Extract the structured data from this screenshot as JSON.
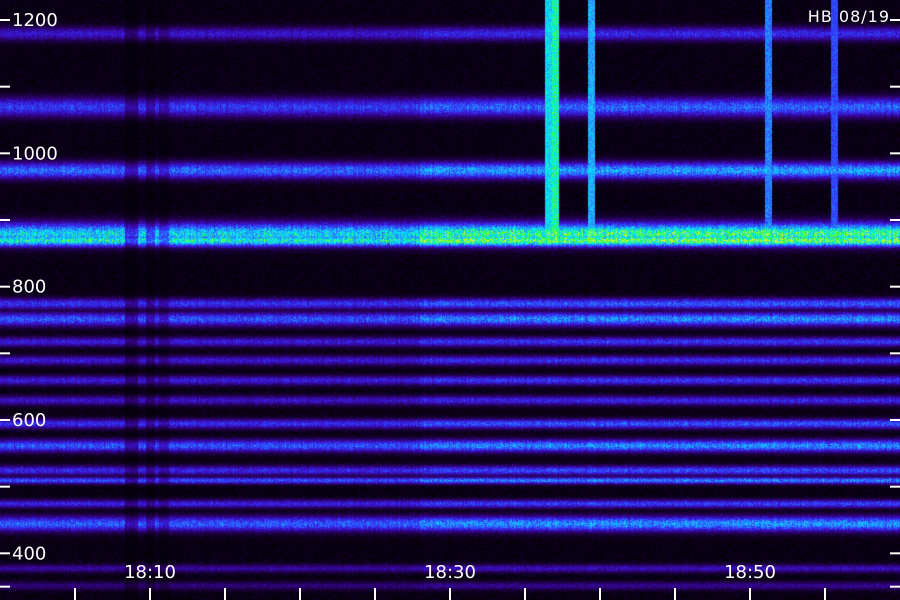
{
  "chart_data": {
    "type": "heatmap",
    "title": "",
    "xlabel": "",
    "ylabel": "",
    "corner_label": "HB 08/19",
    "x_unit": "time (HH:MM)",
    "xlim": [
      "18:00",
      "19:00"
    ],
    "ylim": [
      330,
      1230
    ],
    "y_ticks": [
      {
        "value": 1200,
        "label": "1200"
      },
      {
        "value": 1000,
        "label": "1000"
      },
      {
        "value": 800,
        "label": "800"
      },
      {
        "value": 600,
        "label": "600"
      },
      {
        "value": 400,
        "label": "400"
      }
    ],
    "y_minor_ticks": [
      1100,
      900,
      700,
      500,
      350
    ],
    "x_ticks": [
      {
        "time": "18:10",
        "label": "18:10"
      },
      {
        "time": "18:30",
        "label": "18:30"
      },
      {
        "time": "18:50",
        "label": "18:50"
      }
    ],
    "x_minor_ticks": [
      "18:05",
      "18:15",
      "18:20",
      "18:25",
      "18:35",
      "18:40",
      "18:45",
      "18:55"
    ],
    "colormap": [
      "#000000",
      "#2a0060",
      "#3a10c8",
      "#2f45ff",
      "#25a0ff",
      "#00f0ff",
      "#30ff40",
      "#e8ff20"
    ],
    "segments": [
      {
        "start": "18:00",
        "end": "18:28",
        "gain": 0.82
      },
      {
        "start": "18:28",
        "end": "19:00",
        "gain": 1.0
      }
    ],
    "bands": [
      {
        "freq": 1180,
        "width": 10,
        "intensity": 0.33
      },
      {
        "freq": 1070,
        "width": 14,
        "intensity": 0.45
      },
      {
        "freq": 975,
        "width": 12,
        "intensity": 0.56
      },
      {
        "freq": 880,
        "width": 16,
        "intensity": 0.8
      },
      {
        "freq": 870,
        "width": 9,
        "intensity": 0.88
      },
      {
        "freq": 775,
        "width": 8,
        "intensity": 0.43
      },
      {
        "freq": 752,
        "width": 10,
        "intensity": 0.52
      },
      {
        "freq": 718,
        "width": 7,
        "intensity": 0.36
      },
      {
        "freq": 690,
        "width": 7,
        "intensity": 0.34
      },
      {
        "freq": 660,
        "width": 7,
        "intensity": 0.36
      },
      {
        "freq": 630,
        "width": 7,
        "intensity": 0.32
      },
      {
        "freq": 595,
        "width": 7,
        "intensity": 0.42
      },
      {
        "freq": 562,
        "width": 9,
        "intensity": 0.52
      },
      {
        "freq": 525,
        "width": 7,
        "intensity": 0.4
      },
      {
        "freq": 510,
        "width": 5,
        "intensity": 0.5
      },
      {
        "freq": 475,
        "width": 6,
        "intensity": 0.38
      },
      {
        "freq": 445,
        "width": 11,
        "intensity": 0.54
      },
      {
        "freq": 378,
        "width": 6,
        "intensity": 0.24
      },
      {
        "freq": 352,
        "width": 6,
        "intensity": 0.18
      }
    ],
    "vertical_events": [
      {
        "time": "18:08.7",
        "width_min": 0.3,
        "intensity": -0.4
      },
      {
        "time": "18:10.0",
        "width_min": 0.2,
        "intensity": -0.35
      },
      {
        "time": "18:10.9",
        "width_min": 0.2,
        "intensity": -0.3
      },
      {
        "time": "18:36.6",
        "width_min": 0.15,
        "intensity": 0.8
      },
      {
        "time": "18:37.0",
        "width_min": 0.1,
        "intensity": 0.9
      },
      {
        "time": "18:39.4",
        "width_min": 0.1,
        "intensity": 0.7
      },
      {
        "time": "18:51.2",
        "width_min": 0.1,
        "intensity": 0.6
      },
      {
        "time": "18:55.6",
        "width_min": 0.08,
        "intensity": 0.5
      }
    ]
  }
}
